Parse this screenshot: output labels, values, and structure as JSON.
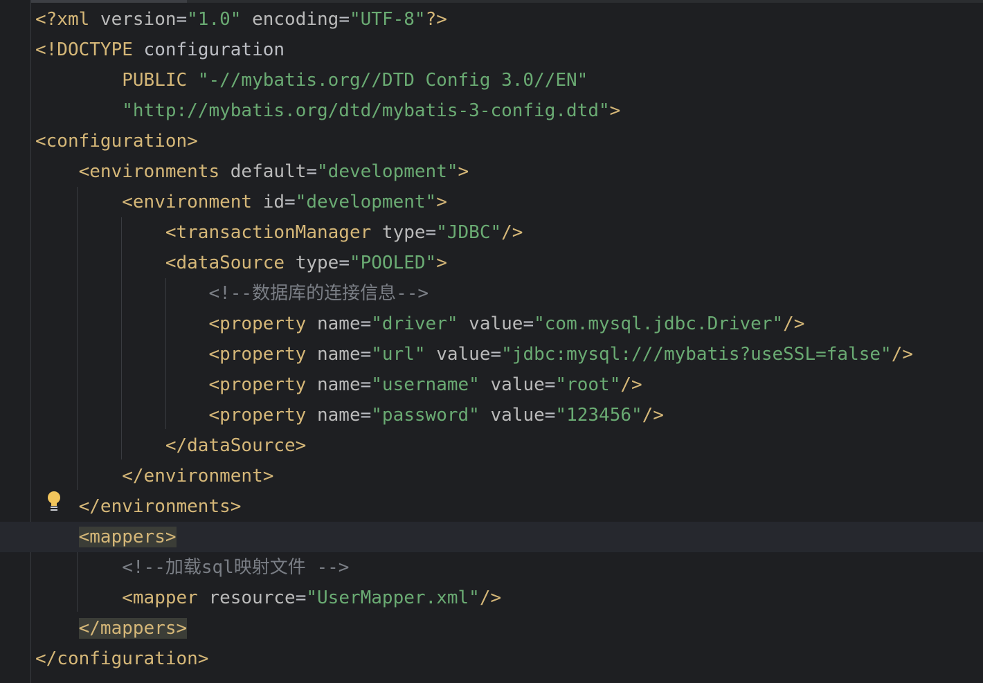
{
  "lines": [
    [
      [
        "t",
        "<?xml "
      ],
      [
        "a",
        "version"
      ],
      [
        "e",
        "="
      ],
      [
        "v",
        "\"1.0\""
      ],
      [
        "e",
        " "
      ],
      [
        "a",
        "encoding"
      ],
      [
        "e",
        "="
      ],
      [
        "v",
        "\"UTF-8\""
      ],
      [
        "t",
        "?>"
      ]
    ],
    [
      [
        "t",
        "<!DOCTYPE "
      ],
      [
        "e",
        "configuration"
      ]
    ],
    [
      [
        "e",
        "        "
      ],
      [
        "d",
        "PUBLIC "
      ],
      [
        "v",
        "\"-//mybatis.org//DTD Config 3.0//EN\""
      ]
    ],
    [
      [
        "e",
        "        "
      ],
      [
        "v",
        "\"http://mybatis.org/dtd/mybatis-3-config.dtd\""
      ],
      [
        "t",
        ">"
      ]
    ],
    [
      [
        "t",
        "<configuration>"
      ]
    ],
    [
      [
        "e",
        "    "
      ],
      [
        "t",
        "<environments "
      ],
      [
        "a",
        "default"
      ],
      [
        "e",
        "="
      ],
      [
        "v",
        "\"development\""
      ],
      [
        "t",
        ">"
      ]
    ],
    [
      [
        "e",
        "        "
      ],
      [
        "t",
        "<environment "
      ],
      [
        "a",
        "id"
      ],
      [
        "e",
        "="
      ],
      [
        "v",
        "\"development\""
      ],
      [
        "t",
        ">"
      ]
    ],
    [
      [
        "e",
        "            "
      ],
      [
        "t",
        "<transactionManager "
      ],
      [
        "a",
        "type"
      ],
      [
        "e",
        "="
      ],
      [
        "v",
        "\"JDBC\""
      ],
      [
        "t",
        "/>"
      ]
    ],
    [
      [
        "e",
        "            "
      ],
      [
        "t",
        "<dataSource "
      ],
      [
        "a",
        "type"
      ],
      [
        "e",
        "="
      ],
      [
        "v",
        "\"POOLED\""
      ],
      [
        "t",
        ">"
      ]
    ],
    [
      [
        "e",
        "                "
      ],
      [
        "c",
        "<!--数据库的连接信息-->"
      ]
    ],
    [
      [
        "e",
        "                "
      ],
      [
        "t",
        "<property "
      ],
      [
        "a",
        "name"
      ],
      [
        "e",
        "="
      ],
      [
        "v",
        "\"driver\""
      ],
      [
        "e",
        " "
      ],
      [
        "a",
        "value"
      ],
      [
        "e",
        "="
      ],
      [
        "v",
        "\"com.mysql.jdbc.Driver\""
      ],
      [
        "t",
        "/>"
      ]
    ],
    [
      [
        "e",
        "                "
      ],
      [
        "t",
        "<property "
      ],
      [
        "a",
        "name"
      ],
      [
        "e",
        "="
      ],
      [
        "v",
        "\"url\""
      ],
      [
        "e",
        " "
      ],
      [
        "a",
        "value"
      ],
      [
        "e",
        "="
      ],
      [
        "v",
        "\"jdbc:mysql:///mybatis?useSSL=false\""
      ],
      [
        "t",
        "/>"
      ]
    ],
    [
      [
        "e",
        "                "
      ],
      [
        "t",
        "<property "
      ],
      [
        "a",
        "name"
      ],
      [
        "e",
        "="
      ],
      [
        "v",
        "\"username\""
      ],
      [
        "e",
        " "
      ],
      [
        "a",
        "value"
      ],
      [
        "e",
        "="
      ],
      [
        "v",
        "\"root\""
      ],
      [
        "t",
        "/>"
      ]
    ],
    [
      [
        "e",
        "                "
      ],
      [
        "t",
        "<property "
      ],
      [
        "a",
        "name"
      ],
      [
        "e",
        "="
      ],
      [
        "v",
        "\"password\""
      ],
      [
        "e",
        " "
      ],
      [
        "a",
        "value"
      ],
      [
        "e",
        "="
      ],
      [
        "v",
        "\"123456\""
      ],
      [
        "t",
        "/>"
      ]
    ],
    [
      [
        "e",
        "            "
      ],
      [
        "t",
        "</dataSource>"
      ]
    ],
    [
      [
        "e",
        "        "
      ],
      [
        "t",
        "</environment>"
      ]
    ],
    [
      [
        "e",
        "    "
      ],
      [
        "t",
        "</environments>"
      ]
    ],
    [
      [
        "e",
        "    "
      ],
      [
        "hl",
        "<mappers>"
      ]
    ],
    [
      [
        "e",
        "        "
      ],
      [
        "c",
        "<!--加载sql映射文件 -->"
      ]
    ],
    [
      [
        "e",
        "        "
      ],
      [
        "t",
        "<mapper "
      ],
      [
        "a",
        "resource"
      ],
      [
        "e",
        "="
      ],
      [
        "v",
        "\"UserMapper.xml\""
      ],
      [
        "t",
        "/>"
      ]
    ],
    [
      [
        "e",
        "    "
      ],
      [
        "hl",
        "</mappers>"
      ]
    ],
    [
      [
        "t",
        "</configuration>"
      ]
    ]
  ],
  "current_line": 17,
  "gutter": {
    "intention_icon": "lightbulb-icon",
    "intention_line": 16
  },
  "colors": {
    "background": "#1e1f22",
    "tag": "#d5b778",
    "attribute": "#bababa",
    "value": "#6aab73",
    "comment": "#7a7e85",
    "plain": "#bcbec4",
    "bulb": "#f2c55c"
  }
}
